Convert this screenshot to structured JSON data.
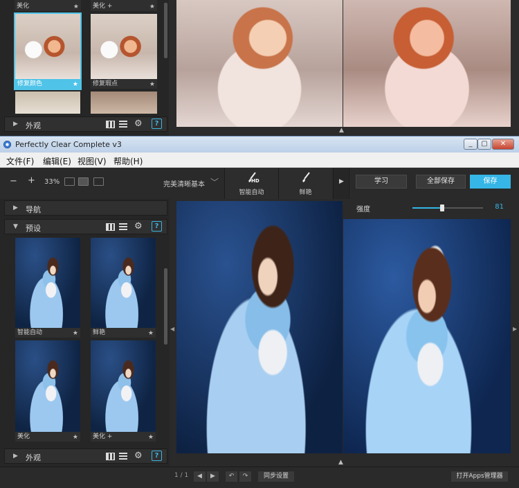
{
  "top_window": {
    "thumbs_row1": [
      {
        "label": "美化"
      },
      {
        "label": "美化 +"
      }
    ],
    "thumbs_row2": [
      {
        "label": "修复颜色",
        "selected": true
      },
      {
        "label": "修复瑕点"
      }
    ],
    "footer_section": "外观"
  },
  "app": {
    "title": "Perfectly Clear Complete v3",
    "window_buttons": [
      "_",
      "▢",
      "✕"
    ]
  },
  "menu": {
    "items": [
      "文件(F)",
      "编辑(E)",
      "视图(V)",
      "帮助(H)"
    ]
  },
  "toolbar": {
    "zoom_minus": "−",
    "zoom_plus": "+",
    "zoom_level": "33%",
    "preset_name": "完美清晰基本",
    "preset_slots": [
      {
        "label": "智能自动",
        "badge": "HD"
      },
      {
        "label": "鲜艳"
      }
    ],
    "learn_label": "学习",
    "save_all_label": "全部保存",
    "save_label": "保存"
  },
  "panel": {
    "nav_title": "导航",
    "presets_title": "预设",
    "appearance_title": "外观",
    "help_glyph": "?",
    "presets": [
      {
        "label": "智能自动"
      },
      {
        "label": "鲜艳"
      },
      {
        "label": "美化"
      },
      {
        "label": "美化 +"
      }
    ],
    "star": "★"
  },
  "adjust": {
    "strength_label": "强度",
    "strength_value": "81",
    "strength_fraction": 0.81
  },
  "status": {
    "page": "1 / 1",
    "sync_label": "同步设置",
    "apps_label": "打开Apps管理器"
  },
  "colors": {
    "accent": "#36b6e6",
    "panel": "#262626",
    "toolbar": "#2a2a2a"
  }
}
